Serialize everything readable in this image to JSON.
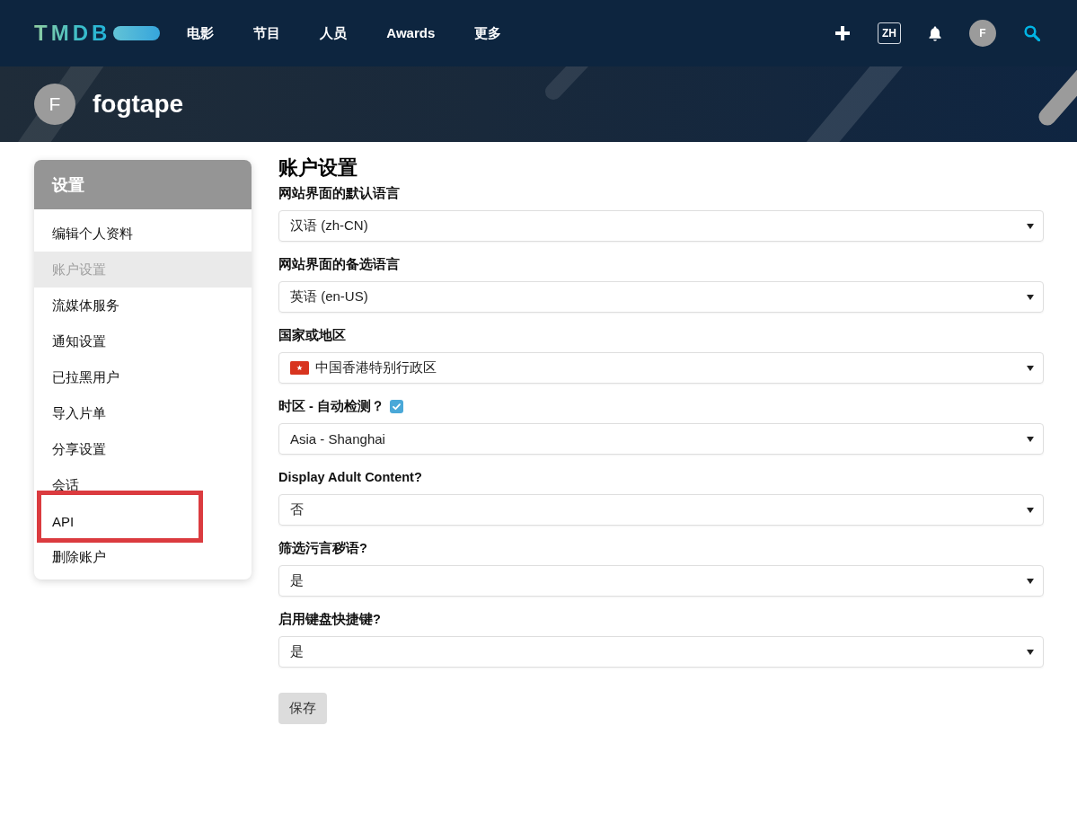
{
  "nav": {
    "logo": "TMDB",
    "links": [
      "电影",
      "节目",
      "人员",
      "Awards",
      "更多"
    ],
    "language": "ZH",
    "avatar_initial": "F"
  },
  "profile": {
    "avatar_initial": "F",
    "username": "fogtape"
  },
  "sidebar": {
    "title": "设置",
    "items": [
      {
        "label": "编辑个人资料",
        "selected": false,
        "highlighted": false
      },
      {
        "label": "账户设置",
        "selected": true,
        "highlighted": false
      },
      {
        "label": "流媒体服务",
        "selected": false,
        "highlighted": false
      },
      {
        "label": "通知设置",
        "selected": false,
        "highlighted": false
      },
      {
        "label": "已拉黑用户",
        "selected": false,
        "highlighted": false
      },
      {
        "label": "导入片单",
        "selected": false,
        "highlighted": false
      },
      {
        "label": "分享设置",
        "selected": false,
        "highlighted": false
      },
      {
        "label": "会话",
        "selected": false,
        "highlighted": false
      },
      {
        "label": "API",
        "selected": false,
        "highlighted": true
      },
      {
        "label": "删除账户",
        "selected": false,
        "highlighted": false
      }
    ]
  },
  "form": {
    "title": "账户设置",
    "fields": [
      {
        "kind": "select",
        "label": "网站界面的默认语言",
        "value": "汉语 (zh-CN)"
      },
      {
        "kind": "select",
        "label": "网站界面的备选语言",
        "value": "英语 (en-US)"
      },
      {
        "kind": "flag-select",
        "label": "国家或地区",
        "value": "中国香港特别行政区"
      },
      {
        "kind": "checkbox-select",
        "label": "时区 - 自动检测？",
        "checked": true,
        "value": "Asia - Shanghai"
      },
      {
        "kind": "select",
        "label": "Display Adult Content?",
        "value": "否"
      },
      {
        "kind": "select",
        "label": "筛选污言秽语?",
        "value": "是"
      },
      {
        "kind": "select",
        "label": "启用键盘快捷键?",
        "value": "是"
      }
    ],
    "save_button": "保存"
  }
}
